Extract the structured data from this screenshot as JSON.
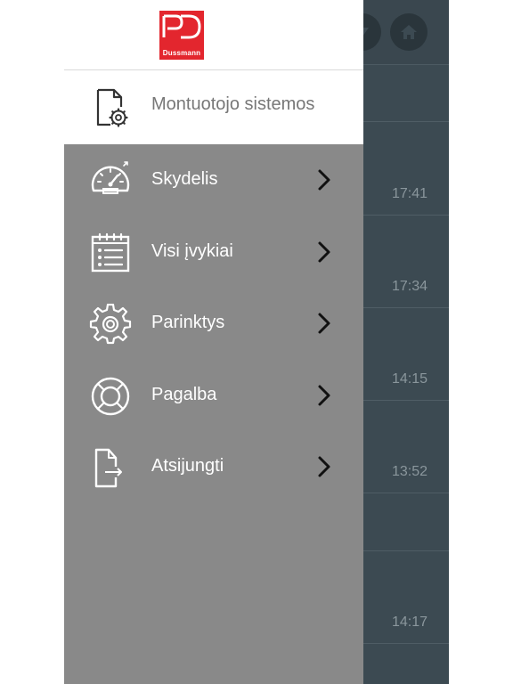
{
  "brand": {
    "name": "Dussmann"
  },
  "drawer": {
    "installer_label": "Montuotojo sistemos",
    "items": [
      {
        "label": "Skydelis",
        "icon": "speedometer-icon"
      },
      {
        "label": "Visi įvykiai",
        "icon": "calendar-list-icon"
      },
      {
        "label": "Parinktys",
        "icon": "gear-icon"
      },
      {
        "label": "Pagalba",
        "icon": "lifebuoy-icon"
      },
      {
        "label": "Atsijungti",
        "icon": "logout-icon"
      }
    ]
  },
  "background": {
    "times": [
      "17:41",
      "17:34",
      "14:15",
      "13:52",
      "14:17"
    ]
  },
  "colors": {
    "drawer_bg": "#898989",
    "brand_red": "#e3262e",
    "app_bg": "#3c4a52"
  }
}
